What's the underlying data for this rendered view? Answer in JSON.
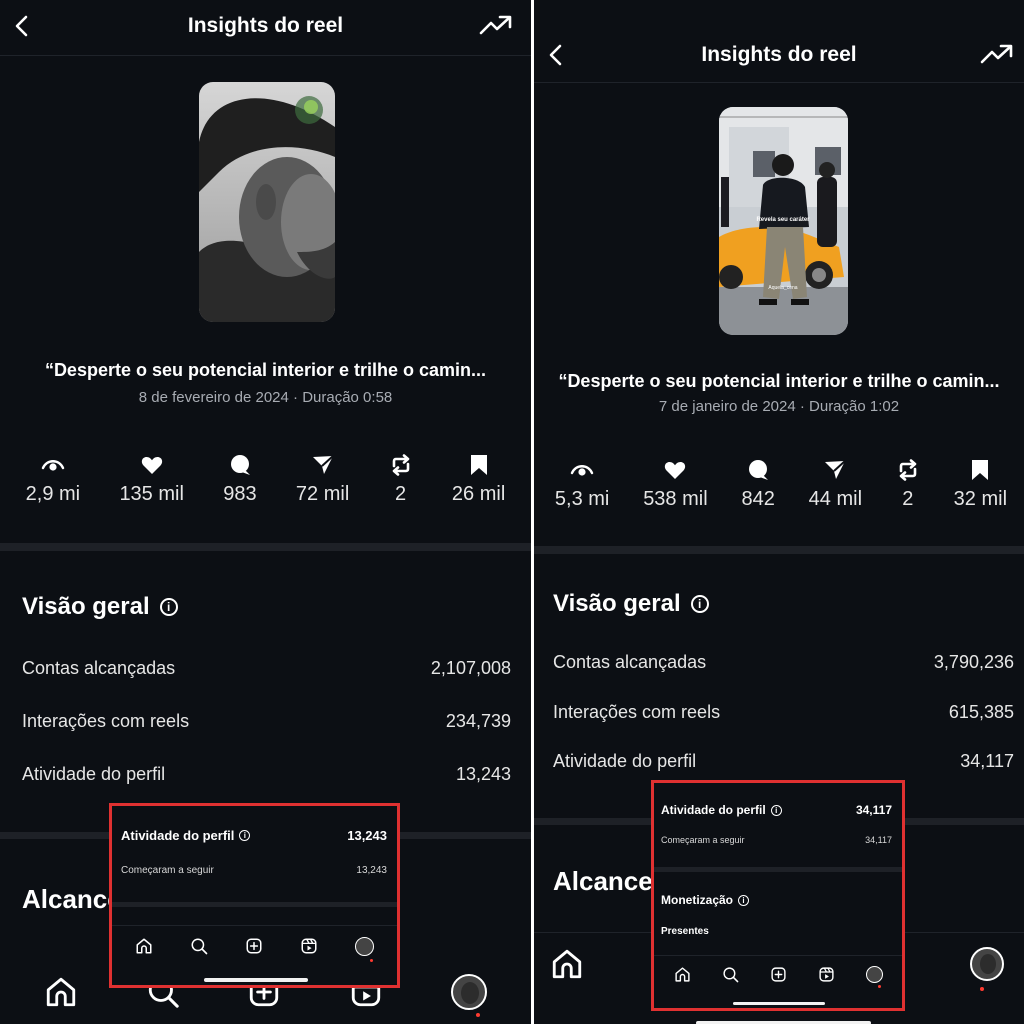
{
  "left": {
    "header_title": "Insights do reel",
    "caption": "“Desperte o seu potencial interior e trilhe o camin...",
    "meta": "8 de fevereiro de 2024 · Duração 0:58",
    "stats": {
      "views": "2,9 mi",
      "likes": "135 mil",
      "comments": "983",
      "shares": "72 mil",
      "reposts": "2",
      "saves": "26 mil"
    },
    "overview_title": "Visão geral",
    "rows": [
      {
        "label": "Contas alcançadas",
        "value": "2,107,008"
      },
      {
        "label": "Interações com reels",
        "value": "234,739"
      },
      {
        "label": "Atividade do perfil",
        "value": "13,243"
      }
    ],
    "reach_title": "Alcance",
    "overlay": {
      "title": "Atividade do perfil",
      "value": "13,243",
      "sub_label": "Começaram a seguir",
      "sub_value": "13,243"
    }
  },
  "right": {
    "header_title": "Insights do reel",
    "caption": "“Desperte o seu potencial interior e trilhe o camin...",
    "meta": "7 de janeiro de 2024 · Duração 1:02",
    "stats": {
      "views": "5,3 mi",
      "likes": "538 mil",
      "comments": "842",
      "shares": "44 mil",
      "reposts": "2",
      "saves": "32 mil"
    },
    "overview_title": "Visão geral",
    "rows": [
      {
        "label": "Contas alcançadas",
        "value": "3,790,236"
      },
      {
        "label": "Interações com reels",
        "value": "615,385"
      },
      {
        "label": "Atividade do perfil",
        "value": "34,117"
      }
    ],
    "reach_title": "Alcance",
    "thumb_text_1": "Revela seu caráter",
    "thumb_text_2": "Aquela_cena",
    "overlay": {
      "title": "Atividade do perfil",
      "value": "34,117",
      "sub_label": "Começaram a seguir",
      "sub_value": "34,117",
      "monet_title": "Monetização",
      "gifts_label": "Presentes"
    }
  },
  "colors": {
    "background": "#0c0f14",
    "highlight": "#e03131",
    "notification": "#ff3b30",
    "car": "#f0a020"
  },
  "icons": [
    "back-arrow-icon",
    "trending-icon",
    "eye-icon",
    "heart-icon",
    "comment-icon",
    "share-icon",
    "repost-icon",
    "bookmark-icon",
    "info-icon",
    "home-icon",
    "search-icon",
    "create-icon",
    "reels-icon",
    "profile-avatar"
  ]
}
